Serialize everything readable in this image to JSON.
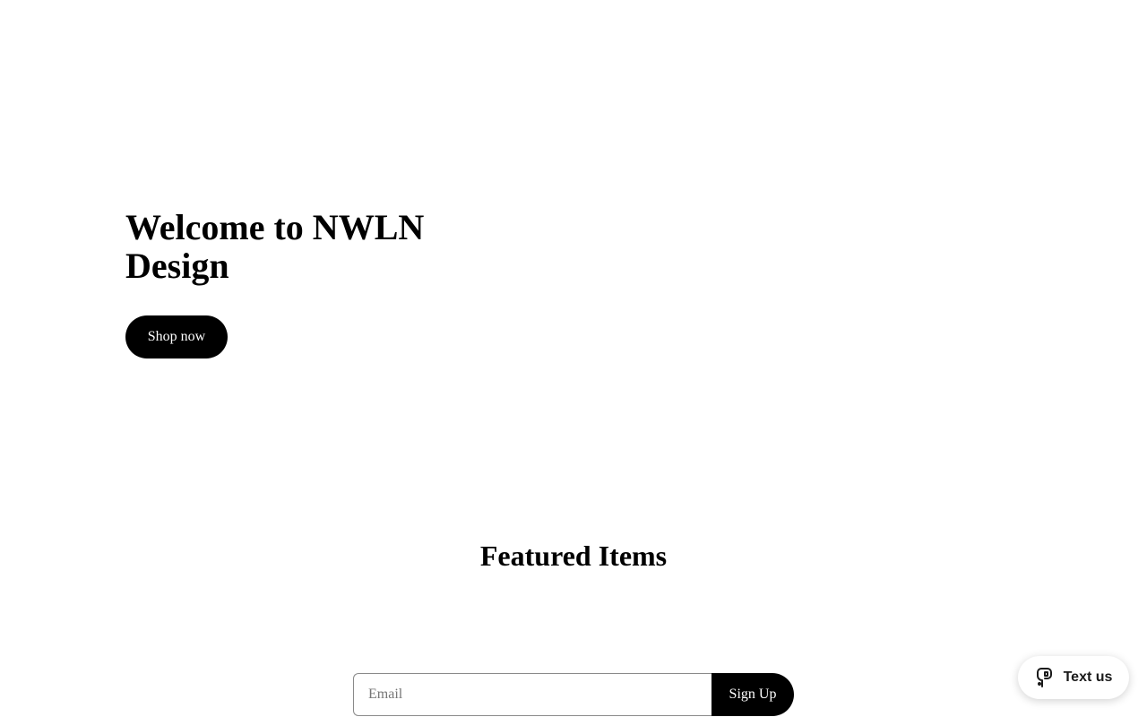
{
  "hero": {
    "title_line1": "Welcome to NWLN",
    "title_line2": "Design",
    "shop_button_label": "Shop now"
  },
  "featured": {
    "title": "Featured Items"
  },
  "newsletter": {
    "email_placeholder": "Email",
    "email_value": "",
    "signup_label": "Sign Up"
  },
  "chat_widget": {
    "label": "Text us",
    "icon": "message-icon"
  },
  "colors": {
    "background": "#ffffff",
    "text": "#000000",
    "button_background": "#000000",
    "button_text": "#ffffff"
  }
}
